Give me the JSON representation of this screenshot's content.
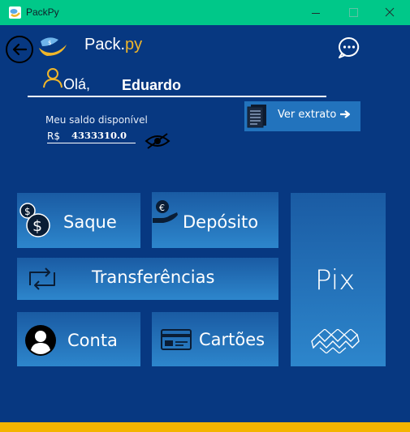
{
  "window": {
    "title": "PackPy"
  },
  "header": {
    "app_name": "Pack.",
    "app_name_accent": "py"
  },
  "greeting": {
    "text": "Olá,",
    "user_name": "Eduardo"
  },
  "balance": {
    "label": "Meu saldo disponível",
    "currency": "R$",
    "value": "4333310.0"
  },
  "statement_button": {
    "label": "Ver extrato"
  },
  "menu": {
    "withdraw": "Saque",
    "deposit": "Depósito",
    "transfers": "Transferências",
    "account": "Conta",
    "cards": "Cartões",
    "pix": "Pix"
  },
  "colors": {
    "titlebar": "#00c889",
    "background": "#073881",
    "tile": "#2273bd",
    "accent": "#f0b629",
    "bottom_bar": "#f4b400"
  },
  "icons": {
    "app": "packpy-logo-icon",
    "back": "back-arrow-icon",
    "chat": "chat-bubble-icon",
    "user": "user-outline-icon",
    "hide_balance": "eye-slash-icon",
    "statement": "document-icon",
    "withdraw": "coins-icon",
    "deposit": "hand-coin-icon",
    "transfers": "transfer-arrows-icon",
    "account": "user-circle-icon",
    "cards": "credit-card-icon",
    "pix": "pix-icon"
  }
}
